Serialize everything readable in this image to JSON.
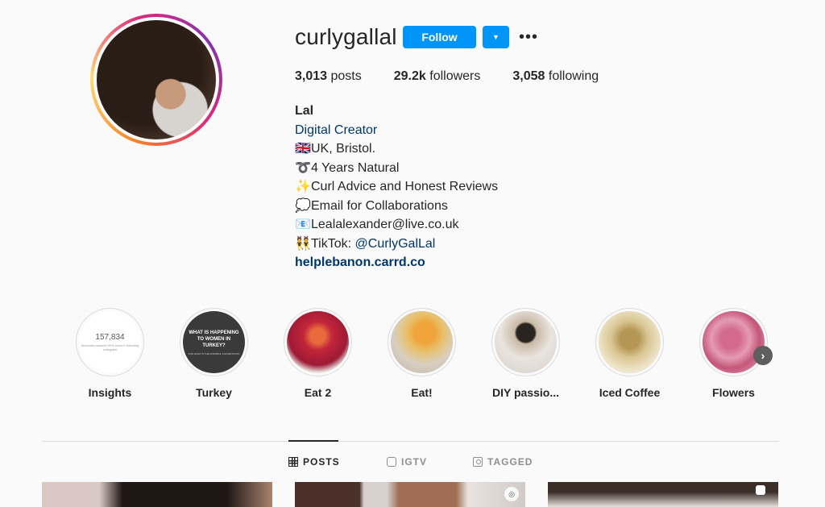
{
  "profile": {
    "username": "curlygallal",
    "follow_label": "Follow",
    "dropdown_icon": "chevron-down-icon",
    "more_label": "•••"
  },
  "stats": {
    "posts": {
      "value": "3,013",
      "label": "posts"
    },
    "followers": {
      "value": "29.2k",
      "label": "followers"
    },
    "following": {
      "value": "3,058",
      "label": "following"
    }
  },
  "bio": {
    "name": "Lal",
    "category": "Digital Creator",
    "lines": [
      {
        "emoji": "🇬🇧",
        "text": "UK, Bristol."
      },
      {
        "emoji": "➰",
        "text": "4 Years Natural"
      },
      {
        "emoji": "✨",
        "text": "Curl Advice and Honest Reviews"
      },
      {
        "emoji": "💭",
        "text": "Email for Collaborations"
      },
      {
        "emoji": "📧",
        "text": "Lealalexander@live.co.uk"
      }
    ],
    "tiktok_emoji": "👯",
    "tiktok_prefix": "TikTok: ",
    "tiktok_handle": "@CurlyGalLal",
    "website": "helplebanon.carrd.co"
  },
  "highlights": {
    "items": [
      {
        "label": "Insights",
        "cover_number": "157,834",
        "cover_sub": "Accounts reached 90% weren't following curlygallal"
      },
      {
        "label": "Turkey",
        "cover_title": "WHAT IS HAPPENING TO WOMEN IN TURKEY?",
        "cover_sub": "AND WHAT IS THE ISTANBUL CONVENTION?"
      },
      {
        "label": "Eat 2"
      },
      {
        "label": "Eat!"
      },
      {
        "label": "DIY passio..."
      },
      {
        "label": "Iced Coffee"
      },
      {
        "label": "Flowers"
      }
    ],
    "next_icon": "chevron-right-icon"
  },
  "tabs": {
    "posts": "POSTS",
    "igtv": "IGTV",
    "tagged": "TAGGED"
  },
  "colors": {
    "primary_button": "#0095f6",
    "link": "#00376b",
    "text": "#262626",
    "muted": "#8e8e8e",
    "background": "#fafafa"
  }
}
